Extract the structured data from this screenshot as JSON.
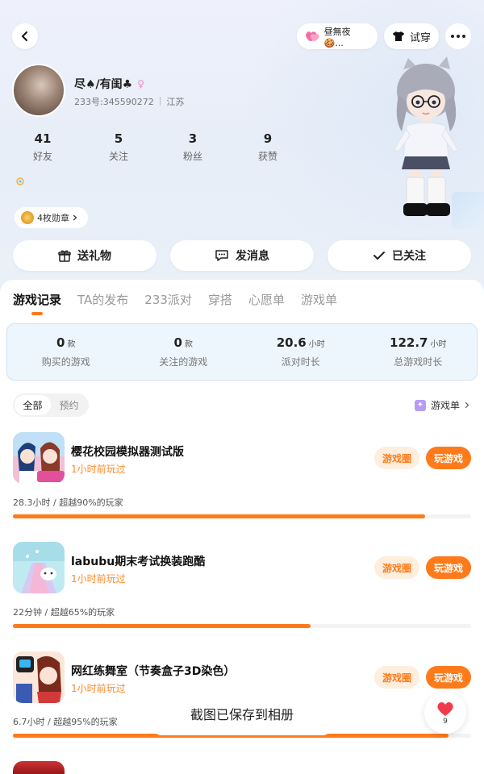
{
  "header": {
    "status_text": "昼無夜🍪...",
    "try_on_label": "试穿"
  },
  "profile": {
    "nickname": "尽♠/有闺♣",
    "id_label": "233号:345590272",
    "location": "江苏",
    "medal_label": "4枚勋章"
  },
  "stats": [
    {
      "value": "41",
      "label": "好友"
    },
    {
      "value": "5",
      "label": "关注"
    },
    {
      "value": "3",
      "label": "粉丝"
    },
    {
      "value": "9",
      "label": "获赞"
    }
  ],
  "actions": {
    "gift": "送礼物",
    "message": "发消息",
    "follow": "已关注"
  },
  "tabs": [
    "游戏记录",
    "TA的发布",
    "233派对",
    "穿搭",
    "心愿单",
    "游戏单"
  ],
  "summary": [
    {
      "value": "0",
      "unit": "款",
      "label": "购买的游戏"
    },
    {
      "value": "0",
      "unit": "款",
      "label": "关注的游戏"
    },
    {
      "value": "20.6",
      "unit": "小时",
      "label": "派对时长"
    },
    {
      "value": "122.7",
      "unit": "小时",
      "label": "总游戏时长"
    }
  ],
  "filter": {
    "all": "全部",
    "reserve": "预约"
  },
  "gamelist_link": "游戏单",
  "games": [
    {
      "name": "樱花校园模拟器测试版",
      "played": "1小时前玩过",
      "stat": "28.3小时 / 超越90%的玩家",
      "progress": 0.9,
      "circle_btn": "游戏圈",
      "play_btn": "玩游戏"
    },
    {
      "name": "labubu期末考试换装跑酷",
      "played": "1小时前玩过",
      "stat": "22分钟 / 超越65%的玩家",
      "progress": 0.65,
      "circle_btn": "游戏圈",
      "play_btn": "玩游戏"
    },
    {
      "name": "网红练舞室（节奏盒子3D染色）",
      "played": "1小时前玩过",
      "stat": "6.7小时 / 超越95%的玩家",
      "progress": 0.95,
      "circle_btn": "游戏圈",
      "play_btn": "玩游戏"
    }
  ],
  "toast": "截图已保存到相册",
  "like_count": "9",
  "colors": {
    "accent": "#ff7a1a",
    "summary_bg": "#eef6fd"
  }
}
